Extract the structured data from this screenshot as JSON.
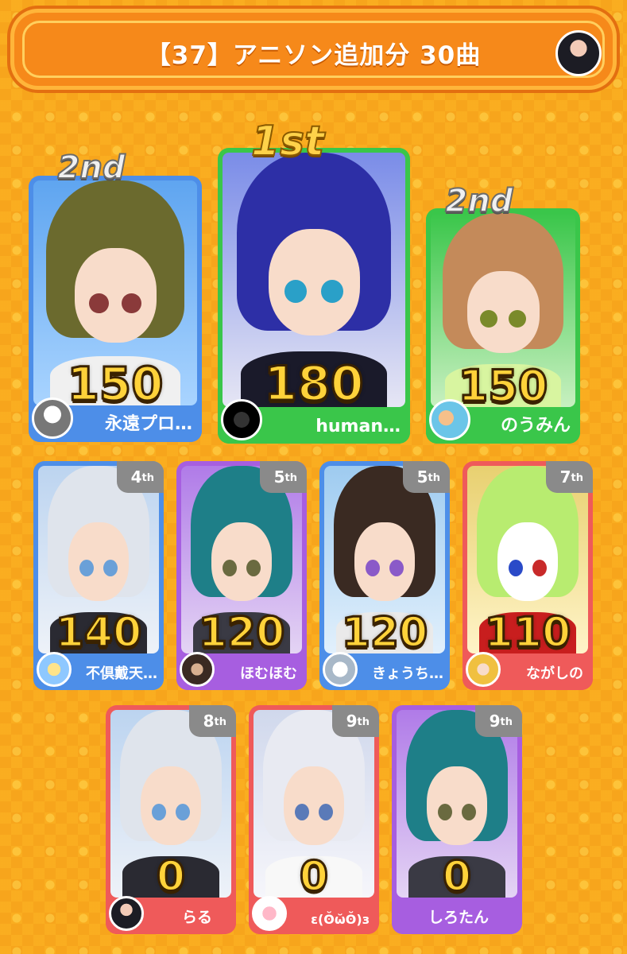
{
  "header": {
    "title": "【37】アニソン追加分 30曲"
  },
  "podium": [
    {
      "rank": "2nd",
      "score": "150",
      "name": "永遠プロ…",
      "card_color": "#4d8ee8"
    },
    {
      "rank": "1st",
      "score": "180",
      "name": "human…",
      "card_color": "#3ac64a"
    },
    {
      "rank": "2nd",
      "score": "150",
      "name": "のうみん",
      "card_color": "#3ac64a"
    }
  ],
  "row2": [
    {
      "rank_num": "4",
      "rank_suffix": "th",
      "score": "140",
      "name": "不倶戴天…",
      "card_color": "#4d8ee8"
    },
    {
      "rank_num": "5",
      "rank_suffix": "th",
      "score": "120",
      "name": "ほむほむ",
      "card_color": "#a75ee0"
    },
    {
      "rank_num": "5",
      "rank_suffix": "th",
      "score": "120",
      "name": "きょうち…",
      "card_color": "#4d8ee8"
    },
    {
      "rank_num": "7",
      "rank_suffix": "th",
      "score": "110",
      "name": "ながしの",
      "card_color": "#ef5a5a"
    }
  ],
  "row3": [
    {
      "rank_num": "8",
      "rank_suffix": "th",
      "score": "0",
      "name": "らる",
      "card_color": "#ef5a5a"
    },
    {
      "rank_num": "9",
      "rank_suffix": "th",
      "score": "0",
      "name": "ε(ʘ̆ω̆ʘ̆)з",
      "card_color": "#ef5a5a"
    },
    {
      "rank_num": "9",
      "rank_suffix": "th",
      "score": "0",
      "name": "しろたん",
      "card_color": "#a75ee0"
    }
  ]
}
